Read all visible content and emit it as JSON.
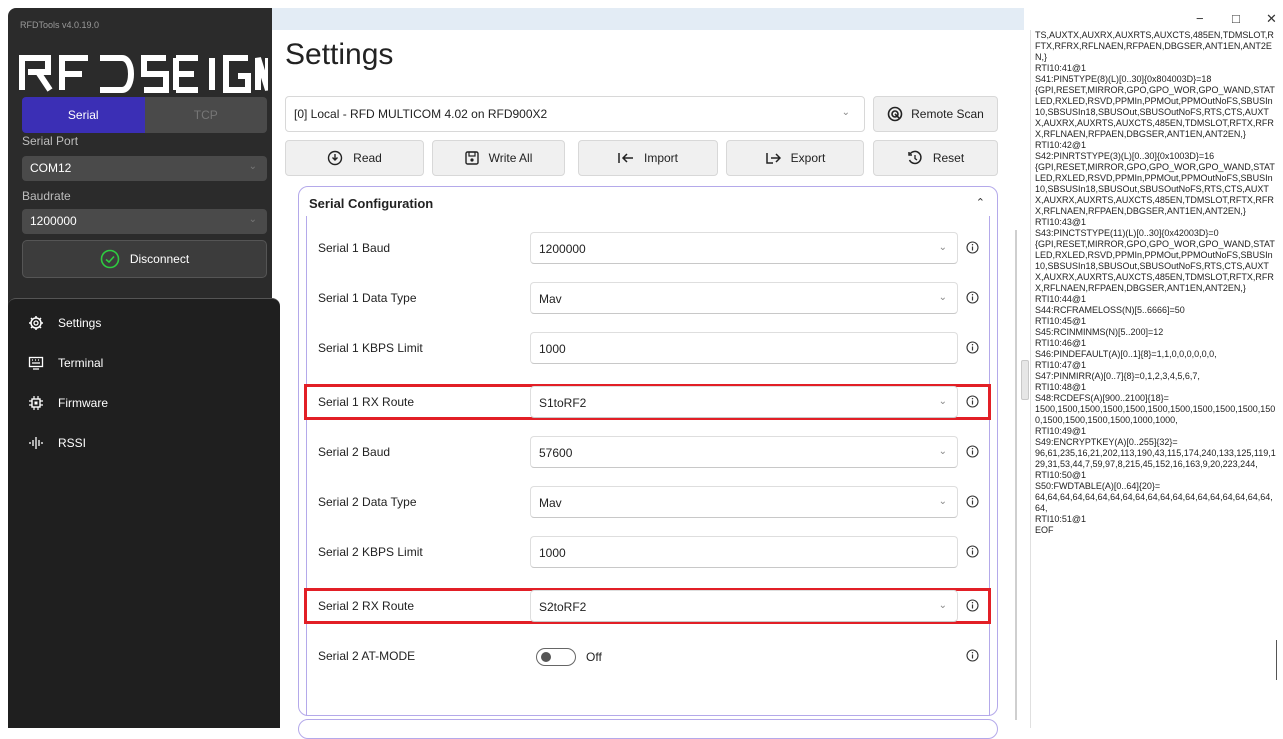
{
  "app": {
    "version_label": "RFDTools v4.0.19.0",
    "logo_text": "RFDESIGN",
    "colors": {
      "accent": "#3b2fb5",
      "highlight": "#e21f26",
      "section_border": "#b4a9ea",
      "connected": "#2ecc40"
    }
  },
  "sidebar": {
    "tabs": [
      {
        "label": "Serial"
      },
      {
        "label": "TCP"
      }
    ],
    "serial_port_label": "Serial Port",
    "serial_port_value": "COM12",
    "baudrate_label": "Baudrate",
    "baudrate_value": "1200000",
    "disconnect_label": "Disconnect",
    "nav": [
      {
        "label": "Settings",
        "icon": "gear-icon"
      },
      {
        "label": "Terminal",
        "icon": "keyboard-icon"
      },
      {
        "label": "Firmware",
        "icon": "chip-icon"
      },
      {
        "label": "RSSI",
        "icon": "signal-icon"
      }
    ]
  },
  "window_controls": {
    "minimize": "−",
    "maximize": "□",
    "close": "✕"
  },
  "main": {
    "title": "Settings",
    "device_select": "[0] Local  - RFD MULTICOM 4.02 on RFD900X2",
    "remote_scan": "Remote Scan",
    "toolbar": [
      {
        "label": "Read",
        "icon": "read-icon"
      },
      {
        "label": "Write All",
        "icon": "save-icon"
      },
      {
        "label": "Import",
        "icon": "import-icon"
      },
      {
        "label": "Export",
        "icon": "export-icon"
      },
      {
        "label": "Reset",
        "icon": "reset-icon"
      }
    ],
    "section_title": "Serial Configuration",
    "rows": [
      {
        "label": "Serial 1 Baud",
        "value": "1200000",
        "kind": "select",
        "highlight": false
      },
      {
        "label": "Serial 1 Data Type",
        "value": "Mav",
        "kind": "select",
        "highlight": false
      },
      {
        "label": "Serial 1 KBPS Limit",
        "value": "1000",
        "kind": "text",
        "highlight": false
      },
      {
        "label": "Serial 1 RX Route",
        "value": "S1toRF2",
        "kind": "select",
        "highlight": true
      },
      {
        "label": "Serial 2 Baud",
        "value": "57600",
        "kind": "select",
        "highlight": false
      },
      {
        "label": "Serial 2 Data Type",
        "value": "Mav",
        "kind": "select",
        "highlight": false
      },
      {
        "label": "Serial 2 KBPS Limit",
        "value": "1000",
        "kind": "text",
        "highlight": false
      },
      {
        "label": "Serial 2 RX Route",
        "value": "S2toRF2",
        "kind": "select",
        "highlight": true
      },
      {
        "label": "Serial 2 AT-MODE",
        "value": "Off",
        "kind": "toggle",
        "highlight": false
      }
    ]
  },
  "log": [
    "TS,AUXTX,AUXRX,AUXRTS,AUXCTS,485EN,TDMSLOT,RFTX,RFRX,RFLNAEN,RFPAEN,DBGSER,ANT1EN,ANT2EN,}",
    "RTI10:41@1",
    "S41:PIN5TYPE(8)(L)[0..30]{0x804003D}=18",
    "{GPI,RESET,MIRROR,GPO,GPO_WOR,GPO_WAND,STATLED,RXLED,RSVD,PPMIn,PPMOut,PPMOutNoFS,SBUSIn10,SBSUSIn18,SBUSOut,SBUSOutNoFS,RTS,CTS,AUXTX,AUXRX,AUXRTS,AUXCTS,485EN,TDMSLOT,RFTX,RFRX,RFLNAEN,RFPAEN,DBGSER,ANT1EN,ANT2EN,}",
    "RTI10:42@1",
    "S42:PINRTSTYPE(3)(L)[0..30]{0x1003D}=16",
    "{GPI,RESET,MIRROR,GPO,GPO_WOR,GPO_WAND,STATLED,RXLED,RSVD,PPMIn,PPMOut,PPMOutNoFS,SBUSIn10,SBSUSIn18,SBUSOut,SBUSOutNoFS,RTS,CTS,AUXTX,AUXRX,AUXRTS,AUXCTS,485EN,TDMSLOT,RFTX,RFRX,RFLNAEN,RFPAEN,DBGSER,ANT1EN,ANT2EN,}",
    "RTI10:43@1",
    "S43:PINCTSTYPE(11)(L)[0..30]{0x42003D}=0",
    "{GPI,RESET,MIRROR,GPO,GPO_WOR,GPO_WAND,STATLED,RXLED,RSVD,PPMIn,PPMOut,PPMOutNoFS,SBUSIn10,SBSUSIn18,SBUSOut,SBUSOutNoFS,RTS,CTS,AUXTX,AUXRX,AUXRTS,AUXCTS,485EN,TDMSLOT,RFTX,RFRX,RFLNAEN,RFPAEN,DBGSER,ANT1EN,ANT2EN,}",
    "RTI10:44@1",
    "S44:RCFRAMELOSS(N)[5..6666]=50",
    "RTI10:45@1",
    "S45:RCINMINMS(N)[5..200]=12",
    "RTI10:46@1",
    "S46:PINDEFAULT(A)[0..1]{8}=1,1,0,0,0,0,0,0,",
    "RTI10:47@1",
    "S47:PINMIRR(A)[0..7]{8}=0,1,2,3,4,5,6,7,",
    "RTI10:48@1",
    "S48:RCDEFS(A)[900..2100]{18}=",
    "1500,1500,1500,1500,1500,1500,1500,1500,1500,1500,1500,1500,1500,1500,1500,1000,1000,",
    "RTI10:49@1",
    "S49:ENCRYPTKEY(A)[0..255]{32}=",
    "96,61,235,16,21,202,113,190,43,115,174,240,133,125,119,129,31,53,44,7,59,97,8,215,45,152,16,163,9,20,223,244,",
    "RTI10:50@1",
    "S50:FWDTABLE(A)[0..64]{20}=",
    "64,64,64,64,64,64,64,64,64,64,64,64,64,64,64,64,64,64,64,64,",
    "RTI10:51@1",
    "EOF"
  ]
}
